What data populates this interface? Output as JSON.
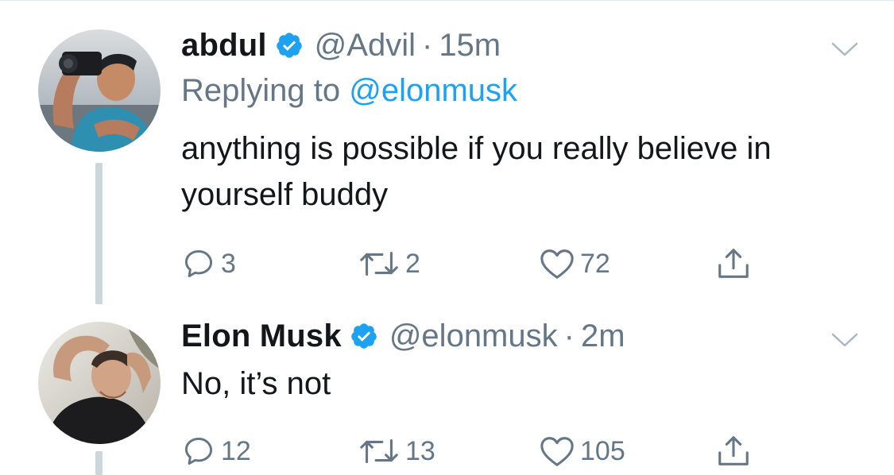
{
  "tweets": [
    {
      "name": "abdul",
      "verified": true,
      "handle": "@Advil",
      "separator": "·",
      "time": "15m",
      "replying_prefix": "Replying to ",
      "replying_to": "@elonmusk",
      "text": "anything is possible if you really believe in yourself buddy",
      "actions": {
        "replies": "3",
        "retweets": "2",
        "likes": "72"
      }
    },
    {
      "name": "Elon Musk",
      "verified": true,
      "handle": "@elonmusk",
      "separator": "·",
      "time": "2m",
      "text": "No, it’s not",
      "actions": {
        "replies": "12",
        "retweets": "13",
        "likes": "105"
      }
    }
  ],
  "colors": {
    "text": "#14171a",
    "secondary": "#657786",
    "link": "#1da1f2",
    "verified": "#1da1f2",
    "thread_line": "#ccd6dd"
  },
  "icons": [
    "verified-badge-icon",
    "chevron-down-icon",
    "reply-icon",
    "retweet-icon",
    "like-icon",
    "share-icon"
  ]
}
